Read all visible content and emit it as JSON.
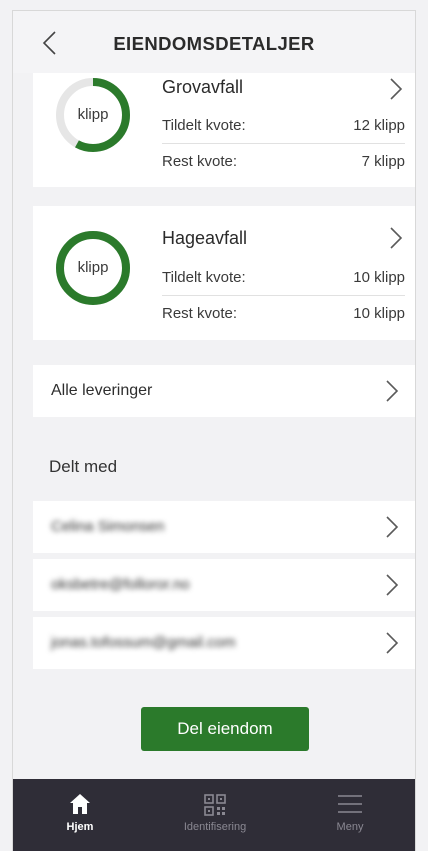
{
  "header": {
    "title": "EIENDOMSDETALJER",
    "back_icon": "chevron-left-icon"
  },
  "quota_cards": [
    {
      "title": "Grovavfall",
      "ring_label": "klipp",
      "allotted_label": "Tildelt kvote:",
      "allotted_value": "12 klipp",
      "remaining_label": "Rest kvote:",
      "remaining_value": "7 klipp",
      "fill_fraction": 0.58
    },
    {
      "title": "Hageavfall",
      "ring_label": "klipp",
      "allotted_label": "Tildelt kvote:",
      "allotted_value": "10 klipp",
      "remaining_label": "Rest kvote:",
      "remaining_value": "10 klipp",
      "fill_fraction": 1.0
    }
  ],
  "all_deliveries": {
    "label": "Alle leveringer"
  },
  "shared_with": {
    "heading": "Delt med",
    "items": [
      "Celina Simonsen",
      "oksbetre@folloror.no",
      "jonas.tofossum@gmail.com"
    ]
  },
  "share_button": {
    "label": "Del eiendom"
  },
  "tabbar": {
    "tabs": [
      {
        "label": "Hjem",
        "icon": "home-icon",
        "active": true
      },
      {
        "label": "Identifisering",
        "icon": "qr-code-icon",
        "active": false
      },
      {
        "label": "Meny",
        "icon": "menu-icon",
        "active": false
      }
    ]
  },
  "colors": {
    "accent_green": "#2b7a2b",
    "ring_track": "#e6e6e6",
    "tabbar_bg": "#2f2d37"
  }
}
